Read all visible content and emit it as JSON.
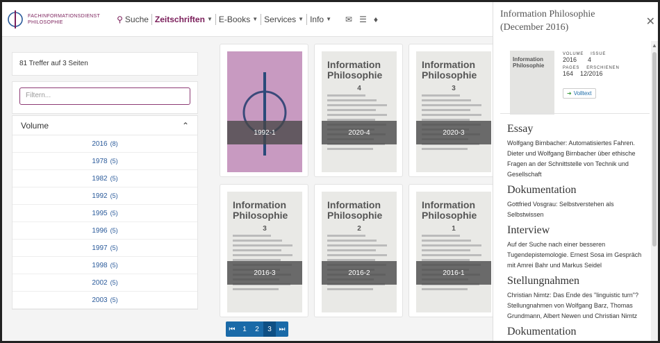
{
  "header": {
    "logo_line1": "FACHINFORMATIONSDIENST",
    "logo_line2": "PHILOSOPHIE",
    "nav": [
      {
        "label": "Suche",
        "icon": "search-icon"
      },
      {
        "label": "Zeitschriften"
      },
      {
        "label": "E-Books"
      },
      {
        "label": "Services"
      },
      {
        "label": "Info"
      }
    ]
  },
  "sidebar": {
    "hits": "81 Treffer auf 3 Seiten",
    "filter_placeholder": "Filtern...",
    "volume_heading": "Volume",
    "volumes": [
      {
        "year": "2016",
        "count": "(8)"
      },
      {
        "year": "1978",
        "count": "(5)"
      },
      {
        "year": "1982",
        "count": "(5)"
      },
      {
        "year": "1992",
        "count": "(5)"
      },
      {
        "year": "1995",
        "count": "(5)"
      },
      {
        "year": "1996",
        "count": "(5)"
      },
      {
        "year": "1997",
        "count": "(5)"
      },
      {
        "year": "1998",
        "count": "(5)"
      },
      {
        "year": "2002",
        "count": "(5)"
      },
      {
        "year": "2003",
        "count": "(5)"
      }
    ]
  },
  "grid": {
    "tiles": [
      {
        "label": "1992-1"
      },
      {
        "label": "2020-4",
        "num": "4"
      },
      {
        "label": "2020-3",
        "num": "3"
      },
      {
        "label": "2016-3",
        "num": "3"
      },
      {
        "label": "2016-2",
        "num": "2"
      },
      {
        "label": "2016-1",
        "num": "1"
      }
    ],
    "cover_title": "Information Philosophie"
  },
  "pager": {
    "first": "⏮",
    "pages": [
      "1",
      "2",
      "3"
    ],
    "last": "⏭"
  },
  "panel": {
    "title": "Information Philosophie (December 2016)",
    "volume_label": "VOLUME",
    "issue_label": "ISSUE",
    "volume": "2016",
    "issue": "4",
    "pages_label": "PAGES",
    "erschienen_label": "ERSCHIENEN",
    "pages": "164",
    "erschienen": "12/2016",
    "volltext": "Volltext",
    "sections": [
      {
        "heading": "Essay",
        "text": "Wolfgang Birnbacher: Automatisiertes Fahren. Dieter und Wolfgang Birnbacher über ethische Fragen an der Schnittstelle von Technik und Gesellschaft"
      },
      {
        "heading": "Dokumentation",
        "text": "Gottfried Vosgrau: Selbstverstehen als Selbstwissen"
      },
      {
        "heading": "Interview",
        "text": "Auf der Suche nach einer besseren Tugendepistemologie. Ernest Sosa im Gespräch mit Amrei Bahr und Markus Seidel"
      },
      {
        "heading": "Stellungnahmen",
        "text": "Christian Nimtz: Das Ende des \"linguistic turn\"? Stellungnahmen von Wolfgang Barz, Thomas Grundmann, Albert Newen und Christian Nimtz"
      },
      {
        "heading": "Dokumentation",
        "text": ""
      }
    ]
  },
  "colors": {
    "brand": "#7a1e5a",
    "link": "#2a5a9a",
    "pager": "#1a6aa8"
  }
}
